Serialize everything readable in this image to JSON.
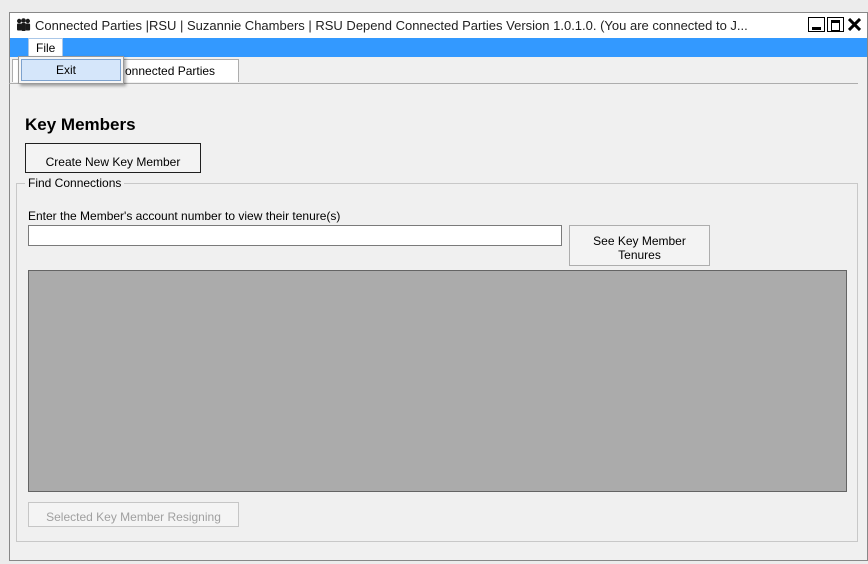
{
  "window": {
    "title": "Connected Parties |RSU | Suzannie Chambers | RSU Depend Connected Parties Version 1.0.1.0. (You are connected to J...",
    "app_icon": "people-group-icon",
    "controls": [
      "minimize-icon",
      "maximize-icon",
      "close-icon"
    ]
  },
  "menubar": {
    "file_label": "File",
    "file_menu": {
      "open": true,
      "items": [
        {
          "label": "Exit"
        }
      ]
    },
    "accent_color": "#3399ff"
  },
  "tabs": [
    {
      "label": "Key Members & Connected Parties",
      "visible_label": "onnected Parties"
    }
  ],
  "main": {
    "section_title": "Key Members",
    "create_button": "Create New Key Member"
  },
  "find": {
    "legend": "Find Connections",
    "prompt": "Enter the Member's account number to view their tenure(s)",
    "account_value": "",
    "see_button_line1": "See Key Member",
    "see_button_line2": "Tenures",
    "resign_button": "Selected Key Member Resigning"
  }
}
